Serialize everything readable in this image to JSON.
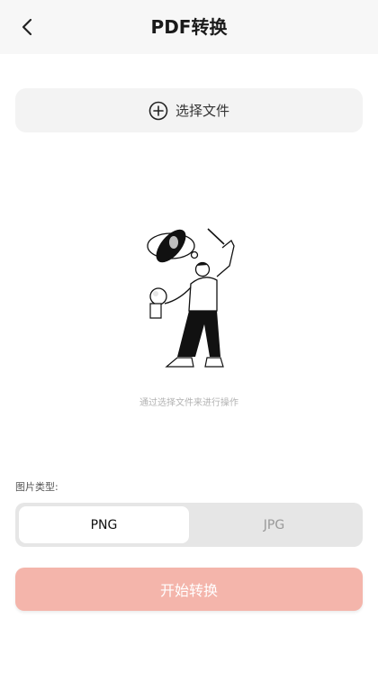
{
  "header": {
    "title": "PDF转换",
    "back_icon": "chevron-left-icon"
  },
  "select_file": {
    "label": "选择文件",
    "icon": "plus-circle-icon"
  },
  "illustration": {
    "name": "person-conducting-illustration"
  },
  "hint": "通过选择文件来进行操作",
  "image_type": {
    "label": "图片类型:",
    "options": [
      {
        "label": "PNG",
        "selected": true
      },
      {
        "label": "JPG",
        "selected": false
      }
    ]
  },
  "start_button": {
    "label": "开始转换",
    "color": "#f4b5ab"
  }
}
